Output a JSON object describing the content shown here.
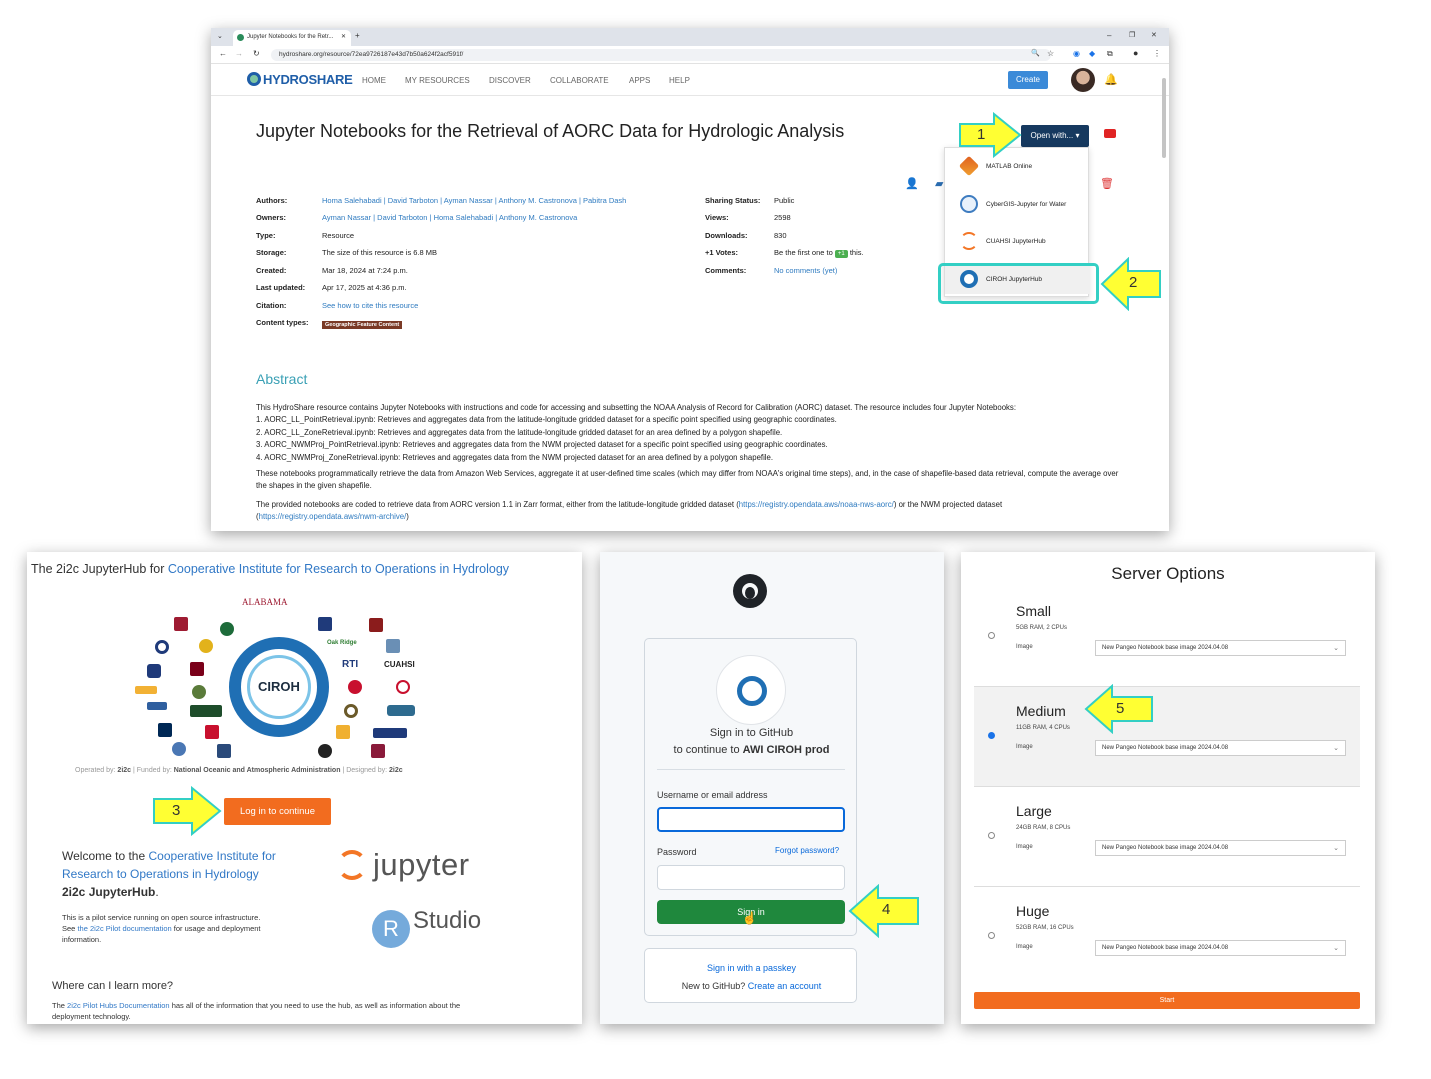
{
  "browser": {
    "tab_title": "Jupyter Notebooks for the Retr...",
    "url": "hydroshare.org/resource/72ea9726187e43d7b50a624f2acf591f/",
    "logo": "HYDROSHARE",
    "nav": [
      "HOME",
      "MY RESOURCES",
      "DISCOVER",
      "COLLABORATE",
      "APPS",
      "HELP"
    ],
    "create": "Create",
    "title": "Jupyter Notebooks for the Retrieval of AORC Data for Hydrologic Analysis",
    "open_with": "Open with... ▾",
    "open_with_items": [
      "MATLAB Online",
      "CyberGIS-Jupyter for Water",
      "CUAHSI JupyterHub",
      "CIROH JupyterHub"
    ],
    "meta_left": [
      {
        "k": "Authors:",
        "v": "Homa Salehabadi | David Tarboton | Ayman Nassar | Anthony M. Castronova | Pabitra Dash",
        "link": true
      },
      {
        "k": "Owners:",
        "v": "Ayman Nassar | David Tarboton | Homa Salehabadi | Anthony M. Castronova",
        "link": true
      },
      {
        "k": "Type:",
        "v": "Resource"
      },
      {
        "k": "Storage:",
        "v": "The size of this resource is 6.8 MB"
      },
      {
        "k": "Created:",
        "v": "Mar 18, 2024 at 7:24 p.m."
      },
      {
        "k": "Last updated:",
        "v": "Apr 17, 2025 at 4:36 p.m."
      },
      {
        "k": "Citation:",
        "v": "See how to cite this resource",
        "link": true
      },
      {
        "k": "Content types:",
        "v": "Geographic Feature Content"
      }
    ],
    "meta_right": [
      {
        "k": "Sharing Status:",
        "v": "Public"
      },
      {
        "k": "Views:",
        "v": "2598"
      },
      {
        "k": "Downloads:",
        "v": "830"
      },
      {
        "k": "+1 Votes:",
        "v_pre": "Be the first one to",
        "vote": "+1",
        "v_post": "this."
      },
      {
        "k": "Comments:",
        "v": "No comments (yet)",
        "link": true
      }
    ],
    "abstract_heading": "Abstract",
    "abstract_p1": [
      "This HydroShare resource contains Jupyter Notebooks with instructions and code for accessing and subsetting the NOAA Analysis of Record for Calibration (AORC) dataset. The resource includes four Jupyter Notebooks:",
      "1. AORC_LL_PointRetrieval.ipynb: Retrieves and aggregates data from the latitude-longitude gridded dataset for a specific point specified using geographic coordinates.",
      "2. AORC_LL_ZoneRetrieval.ipynb: Retrieves and aggregates data from the latitude-longitude gridded dataset for an area defined by a polygon shapefile.",
      "3. AORC_NWMProj_PointRetrieval.ipynb: Retrieves and aggregates data from the NWM projected dataset for a specific point specified using geographic coordinates.",
      "4. AORC_NWMProj_ZoneRetrieval.ipynb: Retrieves and aggregates data from the NWM projected dataset for an area defined by a polygon shapefile."
    ],
    "abstract_p2": "These notebooks programmatically retrieve the data from Amazon Web Services, aggregate it at user-defined time scales (which may differ from NOAA's original time steps), and, in the case of shapefile-based data retrieval, compute the average over the shapes in the given shapefile.",
    "abstract_p3_pre": "The provided notebooks are coded to retrieve data from AORC version 1.1 in Zarr format, either from the latitude-longitude gridded dataset (",
    "abstract_p3_link1": "https://registry.opendata.aws/noaa-nws-aorc/",
    "abstract_p3_mid": ") or the NWM projected dataset (",
    "abstract_p3_link2": "https://registry.opendata.aws/nwm-archive/",
    "abstract_p3_post": ")"
  },
  "hub": {
    "head_pre": "The 2i2c JupyterHub for",
    "head_link": "Cooperative Institute for Research to Operations in Hydrology",
    "alabama": "ALABAMA",
    "center_logo": "CIROH",
    "partner_labels": [
      "RTI",
      "CUAHSI",
      "Oak Ridge"
    ],
    "operated_pre": "Operated by:",
    "operated_by": "2i2c",
    "funded_pre": "| Funded by:",
    "funded_by": "National Oceanic and Atmospheric Administration",
    "designed_pre": "| Designed by:",
    "designed_by": "2i2c",
    "login": "Log in to continue",
    "welcome_pre": "Welcome to the",
    "welcome_link": "Cooperative Institute for Research to Operations in Hydrology",
    "welcome_post": "2i2c JupyterHub",
    "pilot_pre": "This is a pilot service running on open source infrastructure. See",
    "pilot_link": "the 2i2c Pilot documentation",
    "pilot_post": "for usage and deployment information.",
    "learn_heading": "Where can I learn more?",
    "learn_pre": "The",
    "learn_link": "2i2c Pilot Hubs Documentation",
    "learn_post": "has all of the information that you need to use the hub, as well as information about the deployment technology.",
    "jupyter": "jupyter",
    "rstudio_r": "R",
    "rstudio": "Studio"
  },
  "github": {
    "sign_in_to": "Sign in to",
    "sign_in_brand": "GitHub",
    "continue_to": "to continue to",
    "app_name": "AWI CIROH prod",
    "username_label": "Username or email address",
    "password_label": "Password",
    "forgot": "Forgot password?",
    "sign_in": "Sign in",
    "passkey": "Sign in with a passkey",
    "new_pre": "New to GitHub?",
    "create_account": "Create an account"
  },
  "server": {
    "title": "Server Options",
    "image_label": "Image",
    "start": "Start",
    "options": [
      {
        "name": "Small",
        "spec": "5GB RAM, 2 CPUs",
        "image": "New Pangeo Notebook base image 2024.04.08",
        "selected": false
      },
      {
        "name": "Medium",
        "spec": "11GB RAM, 4 CPUs",
        "image": "New Pangeo Notebook base image 2024.04.08",
        "selected": true
      },
      {
        "name": "Large",
        "spec": "24GB RAM, 8 CPUs",
        "image": "New Pangeo Notebook base image 2024.04.08",
        "selected": false
      },
      {
        "name": "Huge",
        "spec": "52GB RAM, 16 CPUs",
        "image": "New Pangeo Notebook base image 2024.04.08",
        "selected": false
      }
    ]
  },
  "steps": [
    "1",
    "2",
    "3",
    "4",
    "5"
  ],
  "colors": {
    "arrow_fill": "#ffff33",
    "arrow_stroke": "#33cfc4",
    "hydroshare_blue": "#1f5ea8",
    "open_with": "#16395f",
    "orange": "#f26c1f",
    "github_green": "#1f883d"
  }
}
